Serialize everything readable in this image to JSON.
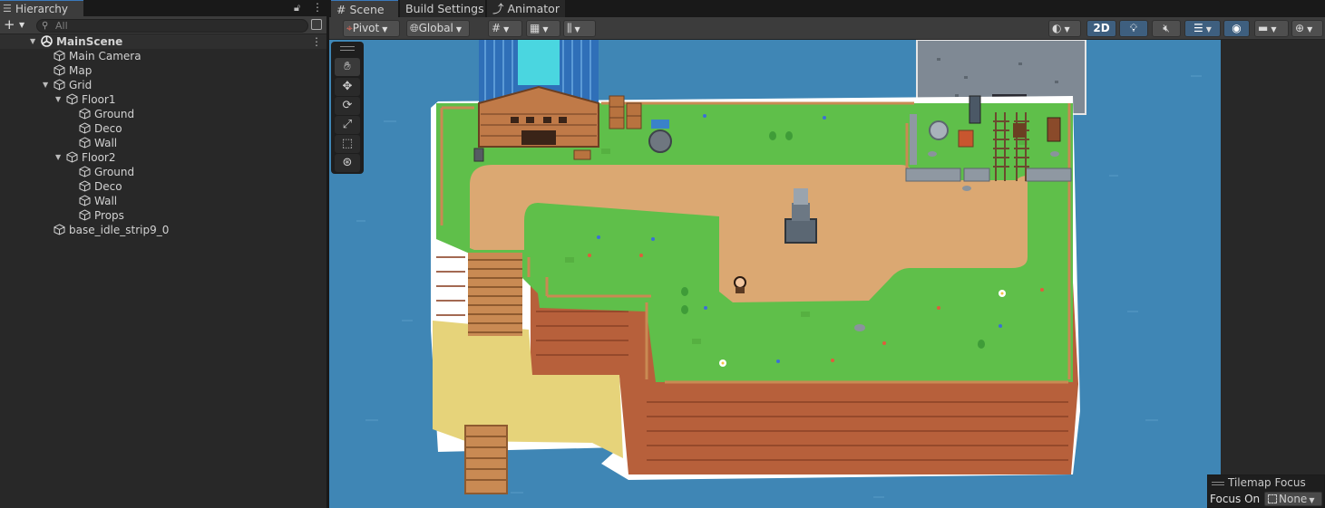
{
  "hierarchy": {
    "tab_label": "Hierarchy",
    "search_placeholder": "All",
    "add_label": "+",
    "scene_name": "MainScene",
    "items": [
      {
        "label": "Main Camera"
      },
      {
        "label": "Map"
      },
      {
        "label": "Grid"
      },
      {
        "label": "Floor1"
      },
      {
        "label": "Ground"
      },
      {
        "label": "Deco"
      },
      {
        "label": "Wall"
      },
      {
        "label": "Floor2"
      },
      {
        "label": "Ground"
      },
      {
        "label": "Deco"
      },
      {
        "label": "Wall"
      },
      {
        "label": "Props"
      },
      {
        "label": "base_idle_strip9_0"
      }
    ]
  },
  "scene": {
    "tabs": [
      {
        "label": "Scene"
      },
      {
        "label": "Build Settings"
      },
      {
        "label": "Animator"
      }
    ],
    "toolbar": {
      "pivot_label": "Pivot",
      "global_label": "Global",
      "mode_2d_label": "2D"
    },
    "tilemap_focus": {
      "title": "Tilemap Focus",
      "focus_on_label": "Focus On",
      "focus_value": "None"
    }
  },
  "colors": {
    "accent": "#3a79bb",
    "water": "#3f86b5",
    "grass": "#5fbf4a",
    "path": "#dba872",
    "cliff": "#b7603b",
    "sand": "#e6d37a"
  }
}
